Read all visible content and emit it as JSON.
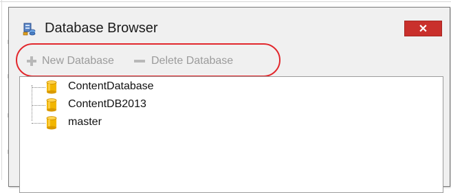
{
  "window": {
    "title": "Database Browser",
    "close_glyph": "✕"
  },
  "toolbar": {
    "new_label": "New Database",
    "delete_label": "Delete Database"
  },
  "tree": {
    "items": [
      {
        "label": "ContentDatabase"
      },
      {
        "label": "ContentDB2013"
      },
      {
        "label": "master"
      }
    ]
  },
  "colors": {
    "close_button": "#c9302c",
    "highlight": "#e2262b",
    "disabled_text": "#9b9b9b",
    "db_icon": "#f0b400"
  },
  "icons": [
    "database-browser-icon",
    "close-icon",
    "plus-icon",
    "minus-icon",
    "database-icon"
  ]
}
